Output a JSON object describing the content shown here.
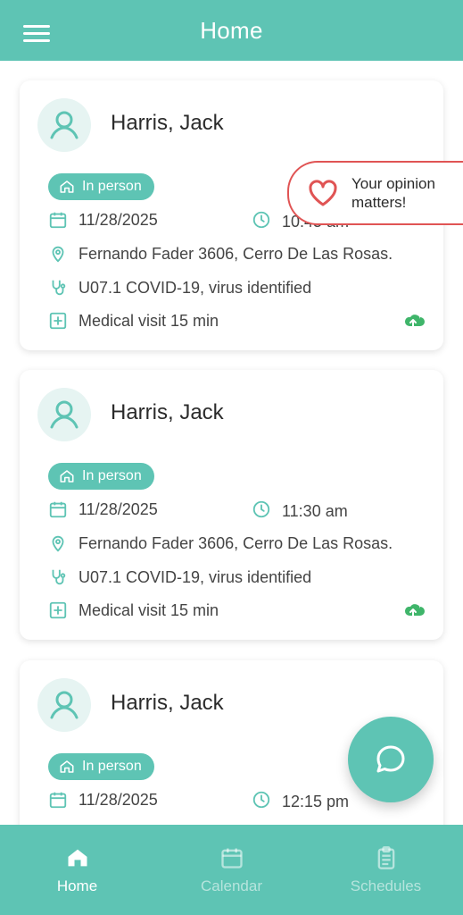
{
  "header": {
    "title": "Home",
    "menu_icon": "hamburger-icon"
  },
  "cards": [
    {
      "name": "Harris, Jack",
      "mode": "In person",
      "date": "11/28/2025",
      "time": "10:45 am",
      "address": "Fernando Fader 3606, Cerro De Las Rosas.",
      "diagnosis": "U07.1 COVID-19, virus identified",
      "visit_type": "Medical visit 15 min"
    },
    {
      "name": "Harris, Jack",
      "mode": "In person",
      "date": "11/28/2025",
      "time": "11:30 am",
      "address": "Fernando Fader 3606, Cerro De Las Rosas.",
      "diagnosis": "U07.1 COVID-19, virus identified",
      "visit_type": "Medical visit 15 min"
    },
    {
      "name": "Harris, Jack",
      "mode": "In person",
      "date": "11/28/2025",
      "time": "12:15 pm"
    }
  ],
  "opinion": {
    "text_line1": "Your opinion",
    "text_line2": "matters!",
    "icon": "heart-icon",
    "accent": "#e05454"
  },
  "fab": {
    "icon": "chat-icon"
  },
  "bottom_nav": {
    "items": [
      {
        "label": "Home",
        "icon": "home-icon",
        "active": true
      },
      {
        "label": "Calendar",
        "icon": "calendar-icon",
        "active": false
      },
      {
        "label": "Schedules",
        "icon": "clipboard-icon",
        "active": false
      }
    ]
  },
  "colors": {
    "primary": "#5ec4b4",
    "text": "#2b2b2b",
    "upload": "#3fb56a"
  }
}
